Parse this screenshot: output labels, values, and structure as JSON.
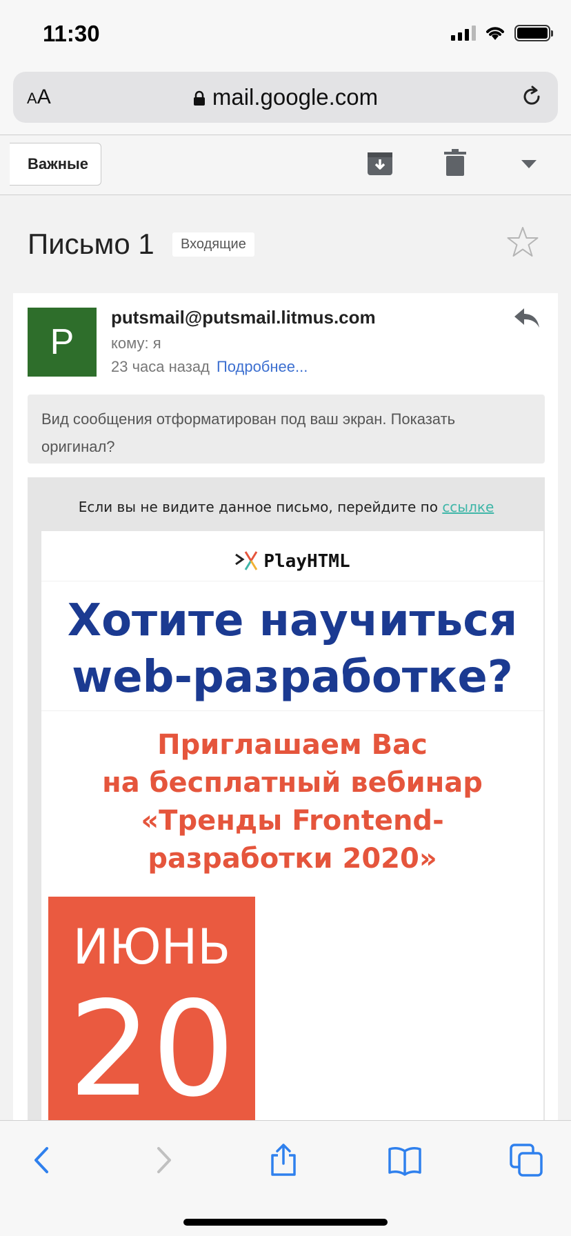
{
  "status": {
    "time": "11:30"
  },
  "browser": {
    "aa": "AA",
    "url": "mail.google.com"
  },
  "toolbar": {
    "back_label": "Важные"
  },
  "message": {
    "subject": "Письмо 1",
    "label": "Входящие",
    "avatar_letter": "P",
    "sender": "putsmail@putsmail.litmus.com",
    "to": "кому: я",
    "time": "23 часа назад",
    "details_link": "Подробнее...",
    "notice": "Вид сообщения отформатирован под ваш экран. Показать оригинал?"
  },
  "email": {
    "preheader_text": "Если вы не видите данное письмо, перейдите по",
    "preheader_link": "ссылке",
    "brand": "PlayHTML",
    "headline_line1": "Хотите научиться",
    "headline_line2": "web-разработке?",
    "invite_line1": "Приглашаем Вас",
    "invite_line2": "на бесплатный вебинар",
    "invite_line3": "«Тренды Frontend-",
    "invite_line4": "разработки 2020»",
    "date_month": "ИЮНЬ",
    "date_day": "20"
  },
  "icons": {
    "lock": "lock-icon",
    "reload": "reload-icon",
    "archive": "archive-icon",
    "trash": "trash-icon",
    "more": "chevron-down-icon",
    "star": "star-icon",
    "reply": "reply-icon",
    "back": "back-icon",
    "forward": "forward-icon",
    "share": "share-icon",
    "bookmarks": "book-icon",
    "tabs": "tabs-icon"
  },
  "colors": {
    "accent_blue": "#1b3a91",
    "accent_red": "#e5553c",
    "date_bg": "#ea5a40",
    "avatar_bg": "#2e6e2b",
    "link": "#3c6fd0",
    "ios_blue": "#2f80ed"
  }
}
